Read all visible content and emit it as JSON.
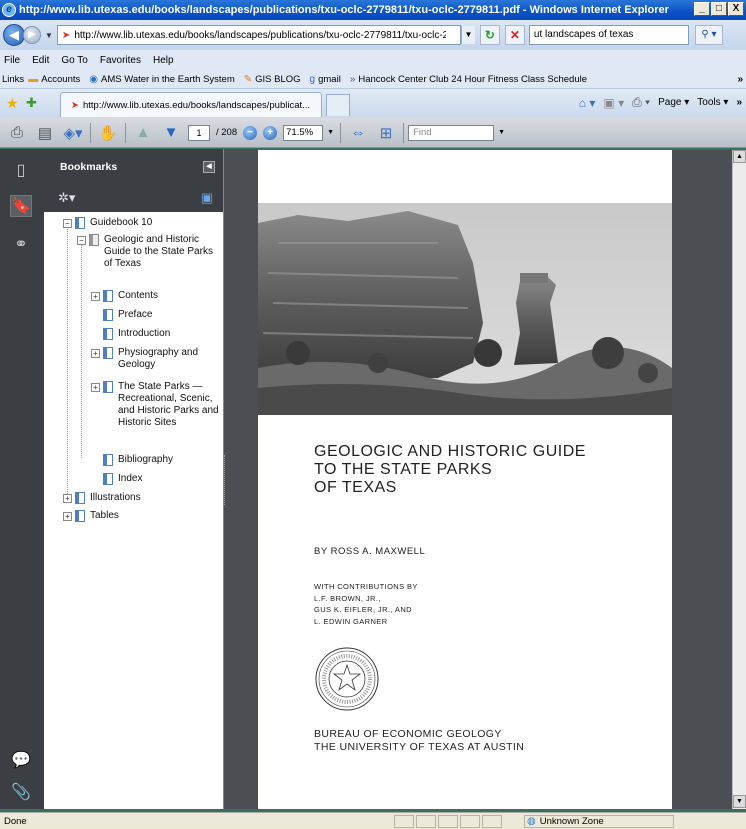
{
  "window": {
    "title": "http://www.lib.utexas.edu/books/landscapes/publications/txu-oclc-2779811/txu-oclc-2779811.pdf - Windows Internet Explorer",
    "minimize": "_",
    "maximize": "□",
    "close": "X"
  },
  "address": {
    "url": "http://www.lib.utexas.edu/books/landscapes/publications/txu-oclc-2779811/txu-oclc-27798",
    "search_value": "ut landscapes of texas"
  },
  "menu": {
    "items": [
      "File",
      "Edit",
      "Go To",
      "Favorites",
      "Help"
    ]
  },
  "links": {
    "label": "Links",
    "items": [
      "Accounts",
      "AMS Water in the Earth System",
      "GIS BLOG",
      "gmail",
      "Hancock Center Club 24 Hour Fitness Class Schedule"
    ]
  },
  "tab": {
    "label": "http://www.lib.utexas.edu/books/landscapes/publicat...",
    "page_menu": "Page",
    "tools_menu": "Tools"
  },
  "pdf_toolbar": {
    "current_page": "1",
    "total_pages": "/ 208",
    "zoom": "71.5%",
    "find_placeholder": "Find"
  },
  "bookmarks": {
    "header": "Bookmarks",
    "items": [
      {
        "label": "Guidebook 10"
      },
      {
        "label": "Geologic and Historic Guide to the State Parks of Texas"
      },
      {
        "label": "Contents"
      },
      {
        "label": "Preface"
      },
      {
        "label": "Introduction"
      },
      {
        "label": "Physiography and Geology"
      },
      {
        "label": "The State Parks — Recreational, Scenic, and Historic Parks and Historic Sites"
      },
      {
        "label": "Bibliography"
      },
      {
        "label": "Index"
      },
      {
        "label": "Illustrations"
      },
      {
        "label": "Tables"
      }
    ]
  },
  "page": {
    "title_lines": [
      "GEOLOGIC AND HISTORIC GUIDE",
      "TO THE STATE PARKS",
      "OF TEXAS"
    ],
    "byline": "BY ROSS A. MAXWELL",
    "contrib_lines": [
      "WITH CONTRIBUTIONS BY",
      "L.F. BROWN, JR.,",
      "GUS K. EIFLER, JR., AND",
      "L. EDWIN GARNER"
    ],
    "publisher_lines": [
      "BUREAU OF ECONOMIC GEOLOGY",
      "THE UNIVERSITY OF TEXAS AT AUSTIN"
    ]
  },
  "status": {
    "text": "Done",
    "zone": "Unknown Zone"
  }
}
